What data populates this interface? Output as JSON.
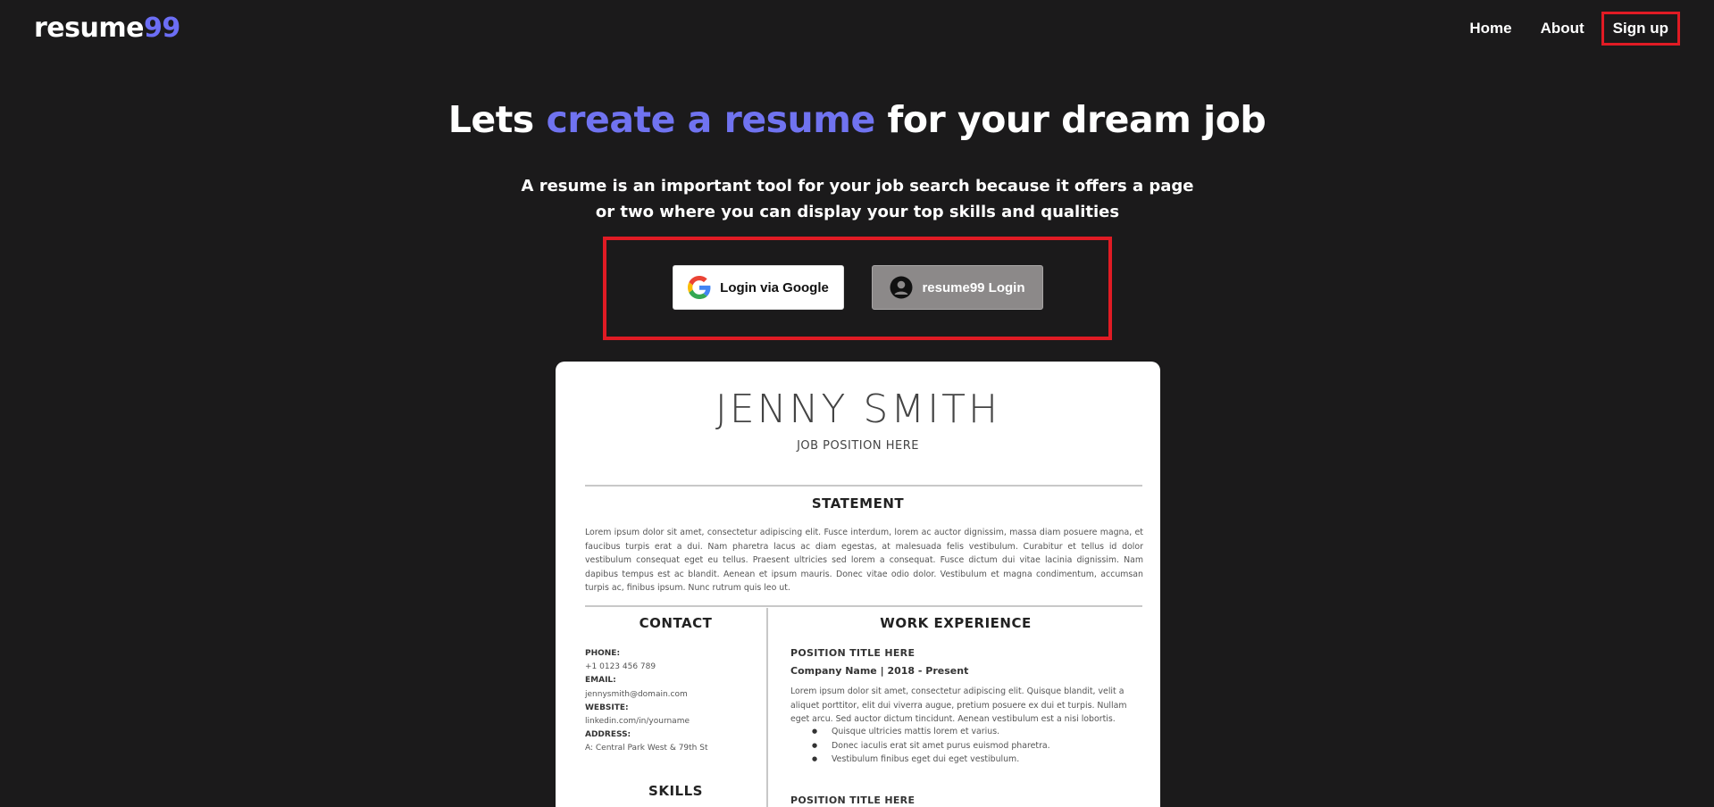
{
  "logo": {
    "text": "resume",
    "accent": "99"
  },
  "nav": {
    "home": "Home",
    "about": "About",
    "signup": "Sign up"
  },
  "hero": {
    "title_pre": "Lets ",
    "title_accent": "create a resume",
    "title_post": " for your dream job",
    "subtitle": "A resume is an important tool for your job search because it offers a page or two where you can display your top skills and qualities"
  },
  "buttons": {
    "google": "Login via Google",
    "resume99": "resume99 Login"
  },
  "resume": {
    "name": "JENNY SMITH",
    "job": "JOB POSITION HERE",
    "statement_heading": "STATEMENT",
    "statement_text": "Lorem ipsum dolor sit amet, consectetur adipiscing elit. Fusce interdum, lorem ac auctor dignissim, massa diam posuere magna, et faucibus turpis erat a dui. Nam pharetra lacus ac diam egestas, at malesuada felis vestibulum. Curabitur et tellus id dolor vestibulum consequat eget eu tellus. Praesent ultricies sed lorem a consequat. Fusce dictum dui vitae lacinia dignissim. Nam dapibus tempus est ac blandit. Aenean et ipsum mauris. Donec vitae odio dolor. Vestibulum et magna condimentum, accumsan turpis ac, finibus ipsum. Nunc rutrum quis leo ut.",
    "contact_heading": "CONTACT",
    "phone_label": "PHONE:",
    "phone": "+1 0123 456 789",
    "email_label": "EMAIL:",
    "email": "jennysmith@domain.com",
    "website_label": "WEBSITE:",
    "website": "linkedin.com/in/yourname",
    "address_label": "ADDRESS:",
    "address": "A: Central Park West & 79th St",
    "skills_heading": "SKILLS",
    "work_heading": "WORK EXPERIENCE",
    "position1": "POSITION TITLE HERE",
    "company1": "Company Name   |   2018 - Present",
    "desc1": "Lorem ipsum dolor sit amet, consectetur adipiscing elit. Quisque blandit, velit a aliquet porttitor, elit dui viverra augue, pretium posuere ex dui et turpis. Nullam eget arcu. Sed auctor dictum tincidunt. Aenean vestibulum est a nisi lobortis.",
    "bullets": [
      "Quisque ultricies mattis lorem et varius.",
      "Donec iaculis erat sit amet purus euismod pharetra.",
      "Vestibulum finibus eget dui eget vestibulum."
    ],
    "position2": "POSITION TITLE HERE"
  },
  "colors": {
    "accent": "#6c6ef5",
    "background": "#1b1a1b",
    "highlight_border": "#e01b24"
  }
}
